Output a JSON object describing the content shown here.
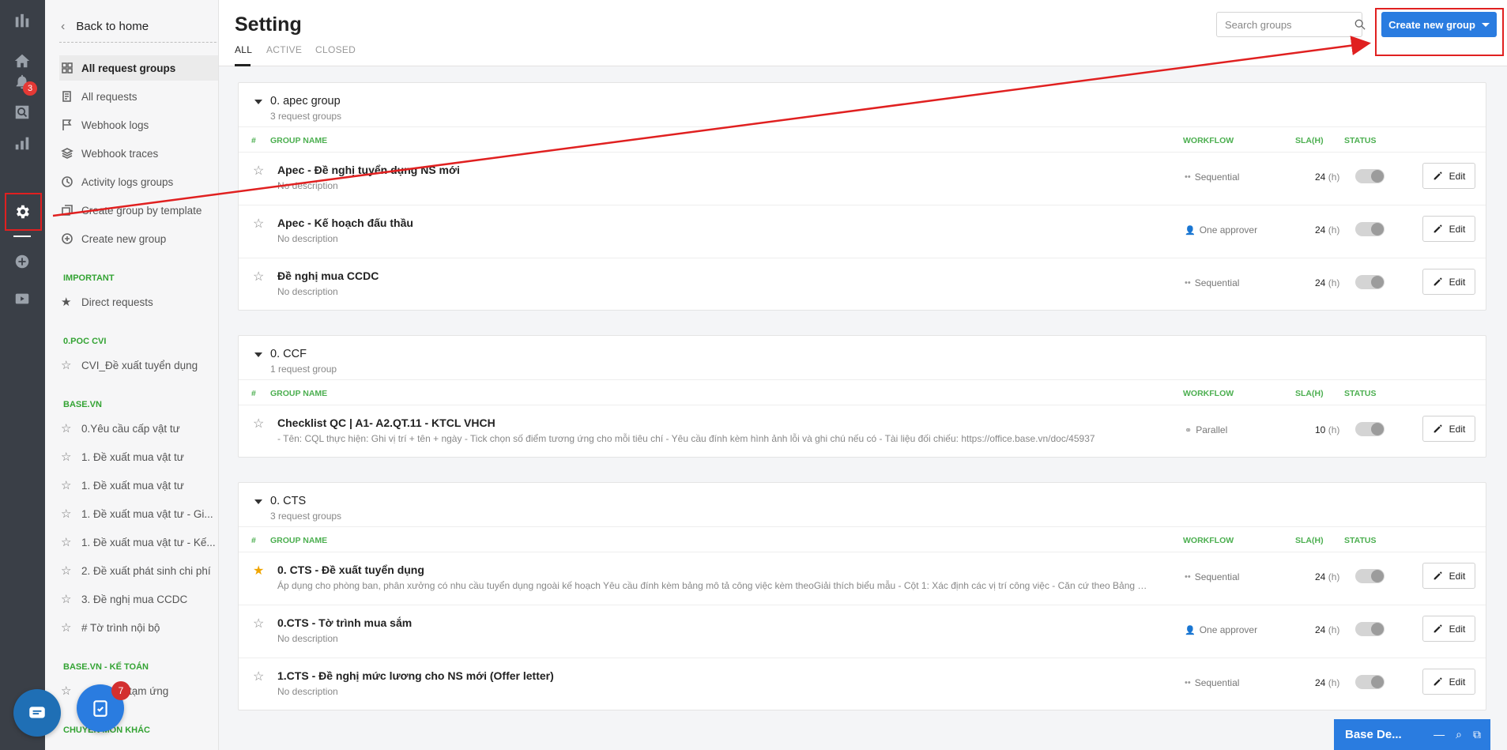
{
  "rail": {
    "notification_count": "3"
  },
  "sidebar": {
    "back_label": "Back to home",
    "items": [
      {
        "label": "All request groups"
      },
      {
        "label": "All requests"
      },
      {
        "label": "Webhook logs"
      },
      {
        "label": "Webhook traces"
      },
      {
        "label": "Activity logs groups"
      },
      {
        "label": "Create group by template"
      },
      {
        "label": "Create new group"
      }
    ],
    "sections": [
      {
        "title": "IMPORTANT",
        "items": [
          "Direct requests"
        ]
      },
      {
        "title": "0.POC CVI",
        "items": [
          "CVI_Đề xuất tuyển dụng"
        ]
      },
      {
        "title": "BASE.VN",
        "items": [
          "0.Yêu cầu cấp vật tư",
          "1. Đề xuất mua vật tư",
          "1. Đề xuất mua vật tư",
          "1. Đề xuất mua vật tư - Gi...",
          "1. Đề xuất mua vật tư - Kế...",
          "2. Đề xuất phát sinh chi phí",
          "3. Đề nghị mua CCDC",
          "# Tờ trình nội bộ"
        ]
      },
      {
        "title": "BASE.VN - KẾ TOÁN",
        "items": [
          "tạm ứng"
        ]
      },
      {
        "title": "CHUYÊN MÔN KHÁC",
        "items": []
      }
    ]
  },
  "header": {
    "title": "Setting",
    "tabs": [
      "ALL",
      "ACTIVE",
      "CLOSED"
    ],
    "search_placeholder": "Search groups",
    "create_button": "Create new group"
  },
  "columns": {
    "num": "#",
    "name": "GROUP NAME",
    "workflow": "WORKFLOW",
    "sla": "SLA(H)",
    "status": "STATUS"
  },
  "edit_label": "Edit",
  "sla_unit": "(h)",
  "groups": [
    {
      "name": "0. apec group",
      "count": "3 request groups",
      "rows": [
        {
          "name": "Apec - Đề nghị tuyển dụng NS mới",
          "desc": "No description",
          "workflow": "Sequential",
          "sla": "24",
          "fav": false
        },
        {
          "name": "Apec - Kế hoạch đấu thầu",
          "desc": "No description",
          "workflow": "One approver",
          "sla": "24",
          "fav": false
        },
        {
          "name": "Đề nghị mua CCDC",
          "desc": "No description",
          "workflow": "Sequential",
          "sla": "24",
          "fav": false
        }
      ]
    },
    {
      "name": "0. CCF",
      "count": "1 request group",
      "rows": [
        {
          "name": "Checklist QC | A1- A2.QT.11 - KTCL VHCH",
          "desc": "- Tên: CQL thực hiện: Ghi vị trí + tên + ngày - Tick chọn số điểm tương ứng cho mỗi tiêu chí - Yêu cầu đính kèm hình ảnh lỗi và ghi chú nếu có - Tài liệu đối chiếu: https://office.base.vn/doc/45937",
          "workflow": "Parallel",
          "sla": "10",
          "fav": false
        }
      ]
    },
    {
      "name": "0. CTS",
      "count": "3 request groups",
      "rows": [
        {
          "name": "0. CTS - Đề xuất tuyển dụng",
          "desc": "Áp dụng cho phòng ban, phân xưởng có nhu cầu tuyển dụng ngoài kế hoạch Yêu cầu đính kèm bảng mô tả công việc kèm theoGiải thích biểu mẫu - Cột 1: Xác định các vị trí công việc - Căn cứ theo Bảng mô tả ...",
          "workflow": "Sequential",
          "sla": "24",
          "fav": true
        },
        {
          "name": "0.CTS - Tờ trình mua sắm",
          "desc": "No description",
          "workflow": "One approver",
          "sla": "24",
          "fav": false
        },
        {
          "name": "1.CTS - Đề nghị mức lương cho NS mới (Offer letter)",
          "desc": "No description",
          "workflow": "Sequential",
          "sla": "24",
          "fav": false
        }
      ]
    }
  ],
  "widgets": {
    "task_count": "7",
    "base_bar": "Base De..."
  },
  "colors": {
    "accent": "#2a7ce0",
    "section_green": "#33a333",
    "annotation_red": "#e02020",
    "rail": "#3a3f47"
  }
}
